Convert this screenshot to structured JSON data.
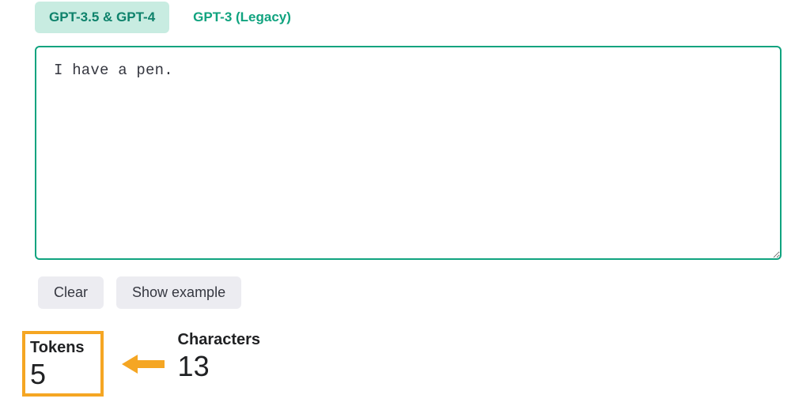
{
  "tabs": {
    "active": "GPT-3.5 & GPT-4",
    "legacy": "GPT-3 (Legacy)"
  },
  "textarea": {
    "value": "I have a pen."
  },
  "buttons": {
    "clear": "Clear",
    "example": "Show example"
  },
  "stats": {
    "tokens": {
      "label": "Tokens",
      "value": "5"
    },
    "characters": {
      "label": "Characters",
      "value": "13"
    }
  },
  "colors": {
    "accent": "#10a37f",
    "highlight": "#f5a623"
  }
}
